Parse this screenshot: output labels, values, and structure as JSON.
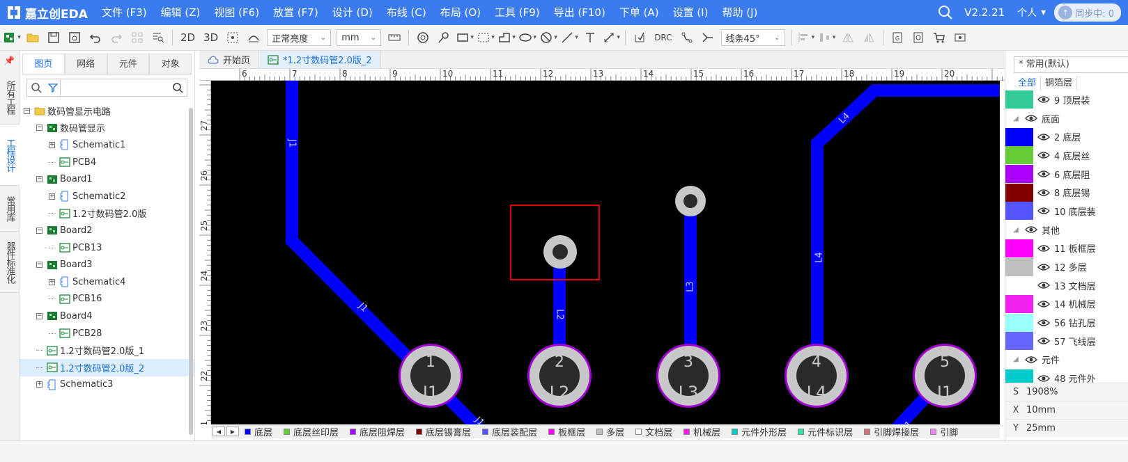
{
  "app": {
    "logo_text": "嘉立创EDA",
    "version": "V2.2.21",
    "user_label": "个人",
    "sync_label": "同步中: 0"
  },
  "menu": [
    "文件 (F3)",
    "编辑 (Z)",
    "视图 (F6)",
    "放置 (F7)",
    "设计 (D)",
    "布线 (C)",
    "布局 (O)",
    "工具 (F9)",
    "导出 (F10)",
    "下单 (A)",
    "设置 (I)",
    "帮助 (J)"
  ],
  "toolbar": {
    "view_2d": "2D",
    "view_3d": "3D",
    "brightness": "正常亮度",
    "unit": "mm",
    "drc": "DRC",
    "route_angle": "线条45°"
  },
  "left_strip": {
    "tabs": [
      "所有工程",
      "工程设计",
      "常用库",
      "器件标准化"
    ]
  },
  "project_panel": {
    "tabs": [
      "图页",
      "网络",
      "元件",
      "对象"
    ],
    "tree": [
      {
        "label": "数码管显示电路",
        "level": 0,
        "toggle": "−",
        "icon": "folder"
      },
      {
        "label": "数码管显示",
        "level": 1,
        "toggle": "−",
        "icon": "board"
      },
      {
        "label": "Schematic1",
        "level": 2,
        "toggle": "+",
        "icon": "schematic"
      },
      {
        "label": "PCB4",
        "level": 2,
        "toggle": "",
        "icon": "pcb"
      },
      {
        "label": "Board1",
        "level": 1,
        "toggle": "−",
        "icon": "board"
      },
      {
        "label": "Schematic2",
        "level": 2,
        "toggle": "+",
        "icon": "schematic"
      },
      {
        "label": "1.2寸数码管2.0版",
        "level": 2,
        "toggle": "",
        "icon": "pcb"
      },
      {
        "label": "Board2",
        "level": 1,
        "toggle": "−",
        "icon": "board"
      },
      {
        "label": "PCB13",
        "level": 2,
        "toggle": "",
        "icon": "pcb"
      },
      {
        "label": "Board3",
        "level": 1,
        "toggle": "−",
        "icon": "board"
      },
      {
        "label": "Schematic4",
        "level": 2,
        "toggle": "+",
        "icon": "schematic"
      },
      {
        "label": "PCB16",
        "level": 2,
        "toggle": "",
        "icon": "pcb"
      },
      {
        "label": "Board4",
        "level": 1,
        "toggle": "−",
        "icon": "board"
      },
      {
        "label": "PCB28",
        "level": 2,
        "toggle": "",
        "icon": "pcb"
      },
      {
        "label": "1.2寸数码管2.0版_1",
        "level": 1,
        "toggle": "",
        "icon": "pcb"
      },
      {
        "label": "1.2寸数码管2.0版_2",
        "level": 1,
        "toggle": "",
        "icon": "pcb",
        "selected": true
      },
      {
        "label": "Schematic3",
        "level": 1,
        "toggle": "+",
        "icon": "schematic"
      }
    ]
  },
  "doc_tabs": [
    {
      "label": "开始页",
      "icon": "cloud-icon",
      "active": false
    },
    {
      "label": "*1.2寸数码管2.0版_2",
      "icon": "pcb-doc-icon",
      "active": true
    }
  ],
  "ruler": {
    "top_labels": [
      "6",
      "7",
      "8",
      "9",
      "10",
      "11",
      "12",
      "13",
      "14",
      "15",
      "16",
      "17",
      "18",
      "19",
      "20"
    ],
    "left_labels": [
      "27",
      "26",
      "25",
      "24",
      "23",
      "22",
      "21"
    ]
  },
  "canvas": {
    "trace_labels": [
      "J1",
      "J1",
      "L2",
      "L3",
      "L4",
      "L4",
      "J1",
      "J1"
    ],
    "pad_numbers": [
      "1",
      "2",
      "3",
      "4",
      "5"
    ],
    "pad_nets": [
      "J1",
      "L2",
      "L3",
      "L4",
      "J1"
    ],
    "colors": {
      "background": "#000000",
      "trace": "#0000ff",
      "pad_outer": "#c8c8c8",
      "pad_inner": "#2b2b2b",
      "pad_ring": "#a000d0",
      "selection": "#e00000"
    }
  },
  "layer_bar": [
    {
      "label": "底层",
      "color": "#0000ff"
    },
    {
      "label": "底层丝印层",
      "color": "#66cc33"
    },
    {
      "label": "底层阻焊层",
      "color": "#aa00ff"
    },
    {
      "label": "底层锡膏层",
      "color": "#800000"
    },
    {
      "label": "底层装配层",
      "color": "#5555ff"
    },
    {
      "label": "板框层",
      "color": "#ff00ff"
    },
    {
      "label": "多层",
      "color": "#c0c0c0"
    },
    {
      "label": "文档层",
      "color": "#ffffff"
    },
    {
      "label": "机械层",
      "color": "#f020f0"
    },
    {
      "label": "元件外形层",
      "color": "#00cccc"
    },
    {
      "label": "元件标识层",
      "color": "#33ddaa"
    },
    {
      "label": "引脚焊接层",
      "color": "#cc7777"
    },
    {
      "label": "引脚",
      "color": "#ee88ee"
    }
  ],
  "layer_panel": {
    "preset": "* 常用(默认)",
    "tabs": [
      "全部",
      "铜箔层"
    ],
    "rows": [
      {
        "type": "layer",
        "color": "#33cc99",
        "label": "9 顶层装"
      },
      {
        "type": "group",
        "label": "底面"
      },
      {
        "type": "layer",
        "color": "#0000ff",
        "label": "2 底层"
      },
      {
        "type": "layer",
        "color": "#66cc33",
        "label": "4 底层丝"
      },
      {
        "type": "layer",
        "color": "#aa00ff",
        "label": "6 底层阻"
      },
      {
        "type": "layer",
        "color": "#800000",
        "label": "8 底层锡"
      },
      {
        "type": "layer",
        "color": "#5555ff",
        "label": "10 底层装"
      },
      {
        "type": "group",
        "label": "其他"
      },
      {
        "type": "layer",
        "color": "#ff00ff",
        "label": "11 板框层"
      },
      {
        "type": "layer",
        "color": "#c0c0c0",
        "label": "12 多层"
      },
      {
        "type": "layer",
        "color": "#ffffff",
        "label": "13 文档层"
      },
      {
        "type": "layer",
        "color": "#f020f0",
        "label": "14 机械层"
      },
      {
        "type": "layer",
        "color": "#99ffff",
        "label": "56 钻孔层"
      },
      {
        "type": "layer",
        "color": "#6666ff",
        "label": "57 飞线层"
      },
      {
        "type": "group",
        "label": "元件"
      },
      {
        "type": "layer",
        "color": "#00cccc",
        "label": "48 元件外"
      }
    ],
    "scale": {
      "key": "S",
      "value": "1908%"
    },
    "x": {
      "key": "X",
      "value": "10mm"
    },
    "y": {
      "key": "Y",
      "value": "25mm"
    }
  }
}
